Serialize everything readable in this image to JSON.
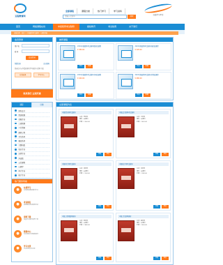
{
  "header": {
    "logo_text": "远程教育网",
    "tabs": [
      "全部课程",
      "课程分类",
      "热门学习",
      "学习资料"
    ],
    "search_placeholder": "请输入关键字",
    "search_button": "搜索",
    "right_logo_text": "在线学习平台"
  },
  "nav": {
    "items": [
      "首页",
      "网络课程在线",
      "中级职称考试辅导",
      "继续教育",
      "考试指南",
      "关于我们"
    ],
    "active_index": 2
  },
  "breadcrumb": "当前位置：首页 > 中级职称考试辅导 > 课程列表",
  "login": {
    "title": "会员登录",
    "user_label": "用户名",
    "pass_label": "密 码",
    "button": "会员登录",
    "links": [
      "免费注册",
      "忘记密码"
    ],
    "note": "登录后可以享受更多的学习服务与资料下载",
    "services": [
      "在线选课",
      "学习中心"
    ]
  },
  "banner": "联系我们 立刻开通",
  "categories": {
    "tabs": [
      "课程",
      "分类"
    ],
    "items": [
      "财务会计",
      "经济管理",
      "金融专业",
      "工商管理",
      "人力资源",
      "建筑工程",
      "卫生系列",
      "教育系列",
      "计算机类",
      "农业专业",
      "法律专业",
      "外语类",
      "公共课程",
      "心理学",
      "审计专业",
      "统计专业",
      "其他课程"
    ]
  },
  "service": {
    "title": "热门服务导航",
    "items": [
      {
        "icon": "●",
        "title": "在线学习",
        "desc": "在线视频课程随时学习"
      },
      {
        "icon": "●",
        "title": "考试报名",
        "desc": "快速报名参加各类考试"
      },
      {
        "icon": "●",
        "title": "资料下载",
        "desc": "海量学习资料免费下载"
      },
      {
        "icon": "●",
        "title": "客服中心",
        "desc": "专业客服为您解答疑问"
      },
      {
        "icon": "●",
        "title": "学习交流",
        "desc": "学员在线交流讨论"
      }
    ]
  },
  "featured": {
    "title": "推荐课程",
    "items": [
      {
        "title": "2024中级职称考试辅导精讲班课程",
        "price": "¥ 380.00",
        "btn1": "购买",
        "btn2": "收藏"
      },
      {
        "title": "2024中级职称考试辅导强化班课程",
        "price": "¥ 420.00",
        "btn1": "购买",
        "btn2": "收藏"
      },
      {
        "title": "2024中级职称考试辅导冲刺班课程",
        "price": "¥ 260.00",
        "btn1": "购买",
        "btn2": "收藏"
      },
      {
        "title": "2024中级职称考试辅导全程班课程",
        "price": "¥ 680.00",
        "btn1": "购买",
        "btn2": "收藏"
      }
    ]
  },
  "products": {
    "title": "全部课程列表",
    "items": [
      {
        "title": "中级经济师考试辅导",
        "lines": [
          "主讲：李老师",
          "课时：48课时",
          "价格：¥ 360.00"
        ],
        "btn1": "详情",
        "btn2": "购买"
      },
      {
        "title": "中级会计职称考试辅导",
        "lines": [
          "主讲：王老师",
          "课时：56课时",
          "价格：¥ 420.00"
        ],
        "btn1": "详情",
        "btn2": "购买"
      },
      {
        "title": "中级审计师考试辅导",
        "lines": [
          "主讲：张老师",
          "课时：40课时",
          "价格：¥ 300.00"
        ],
        "btn1": "详情",
        "btn2": "购买"
      },
      {
        "title": "中级统计师考试辅导",
        "lines": [
          "主讲：刘老师",
          "课时：36课时",
          "价格：¥ 280.00"
        ],
        "btn1": "详情",
        "btn2": "购买"
      },
      {
        "title": "中级工程师职称辅导",
        "lines": [
          "主讲：陈老师",
          "课时：60课时",
          "价格：¥ 480.00"
        ],
        "btn1": "详情",
        "btn2": "购买"
      },
      {
        "title": "中级卫生职称辅导",
        "lines": [
          "主讲：赵老师",
          "课时：52课时",
          "价格：¥ 400.00"
        ],
        "btn1": "详情",
        "btn2": "购买"
      }
    ]
  },
  "colors": {
    "primary": "#1a8dd4",
    "accent": "#ff7a1a",
    "light": "#e6f1fa"
  }
}
